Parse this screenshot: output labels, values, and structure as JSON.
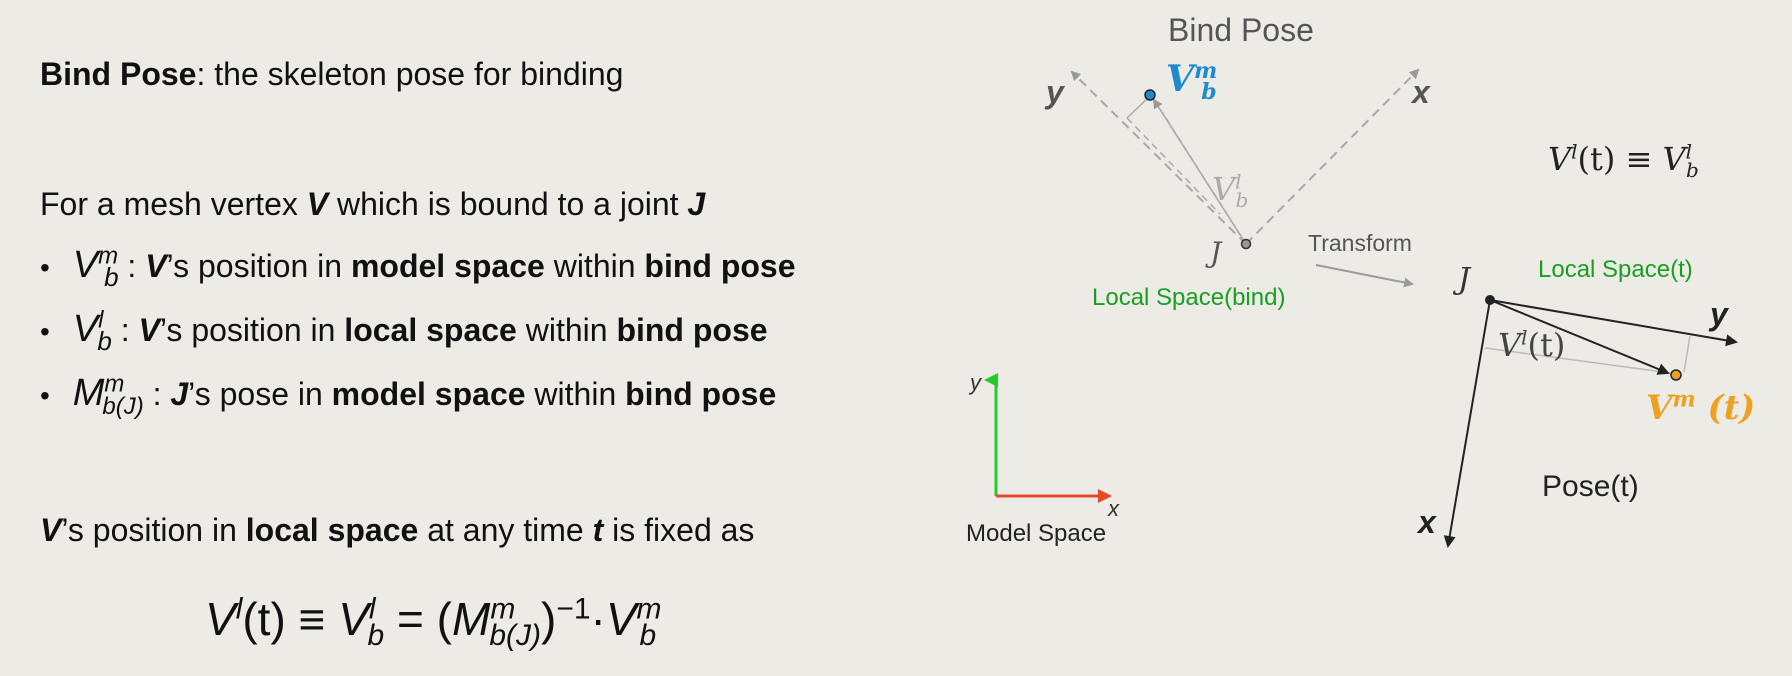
{
  "slide": {
    "intro": {
      "term": "Bind Pose",
      "rest": ": the skeleton pose for binding"
    },
    "vertex_line": {
      "pre": "For a mesh vertex ",
      "v": "V",
      "mid": " which is bound to a joint ",
      "j": "J"
    },
    "bullets": [
      {
        "sym": "V",
        "sup": "m",
        "sub": "b",
        "colon": " : ",
        "subj": "V",
        "apos": "’s position in ",
        "space": "model space",
        "within": " within ",
        "pose": "bind pose"
      },
      {
        "sym": "V",
        "sup": "l",
        "sub": "b",
        "colon": "  : ",
        "subj": "V",
        "apos": "’s position in ",
        "space": "local space",
        "within": " within ",
        "pose": "bind pose"
      },
      {
        "sym": "M",
        "sup": "m",
        "sub": "b(J)",
        "colon": " : ",
        "subj": "J",
        "apos": "’s pose in ",
        "space": "model space",
        "within": " within ",
        "pose": "bind pose"
      }
    ],
    "fixed_line": {
      "v": "V",
      "pre": "’s position in ",
      "space": "local space",
      "mid": " at any time ",
      "t": "t",
      "post": " is fixed as"
    },
    "equation": {
      "lhs": "V",
      "lhs_sup": "l",
      "lhs_arg": "(t) ≡ ",
      "v": "V",
      "v_sup": "l",
      "v_sub": "b",
      "eq": " = (",
      "m": "M",
      "m_sup": "m",
      "m_sub": "b(J)",
      "close": ")",
      "inv": "−1",
      "dot": "·",
      "v2": "V",
      "v2_sup": "m",
      "v2_sub": "b"
    }
  },
  "diagram": {
    "bind_pose_title": "Bind Pose",
    "vbm": {
      "base": "V",
      "sup": "m",
      "sub": "b"
    },
    "vbl": {
      "base": "V",
      "sup": "l",
      "sub": "b"
    },
    "axis_y": "y",
    "axis_x": "x",
    "joint": "J",
    "local_space_bind": "Local Space(bind)",
    "transform": "Transform",
    "identity": {
      "base": "V",
      "sup": "l",
      "arg": "(t) ≡ ",
      "rhs": "V",
      "rhs_sup": "l",
      "rhs_sub": "b"
    },
    "local_space_t": "Local Space(t)",
    "vlt": {
      "base": "V",
      "sup": "l",
      "arg": "(t)"
    },
    "vmt": {
      "base": "V",
      "sup": "m",
      "arg": " (t)"
    },
    "pose_t": "Pose(t)",
    "model_space": "Model Space",
    "ms_y": "y",
    "ms_x": "x"
  },
  "colors": {
    "background": "#ecebe6",
    "vbm_blue": "#1c8bd0",
    "green_label": "#1a9e22",
    "orange_point": "#f0a020",
    "axis_green": "#22cc22",
    "axis_red": "#e8492a"
  }
}
